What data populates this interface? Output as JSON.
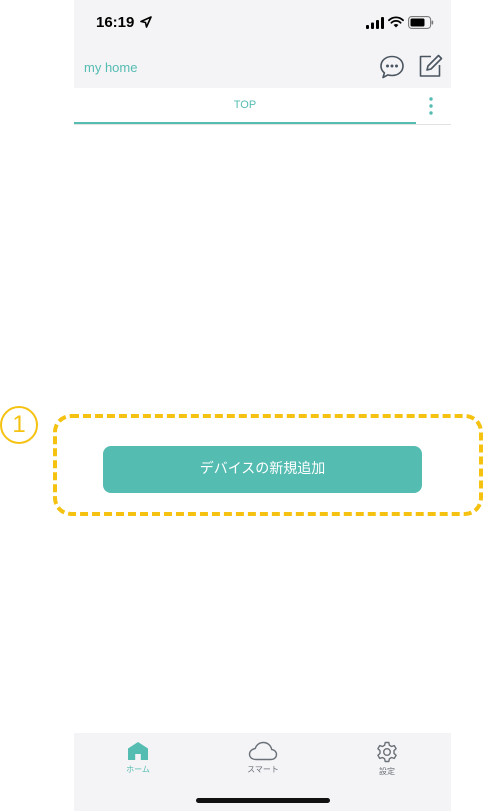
{
  "status_bar": {
    "time": "16:19"
  },
  "nav": {
    "home_name": "my home"
  },
  "tabs": [
    {
      "label": "TOP"
    }
  ],
  "main": {
    "add_device_button": "デバイスの新規追加"
  },
  "bottom_nav": [
    {
      "label": "ホーム",
      "icon": "home-icon"
    },
    {
      "label": "スマート",
      "icon": "cloud-icon"
    },
    {
      "label": "設定",
      "icon": "gear-icon"
    }
  ],
  "annotation": {
    "marker": "1"
  },
  "colors": {
    "accent": "#55bcb2",
    "annotation": "#f5c211",
    "bar_bg": "#f4f4f6"
  }
}
